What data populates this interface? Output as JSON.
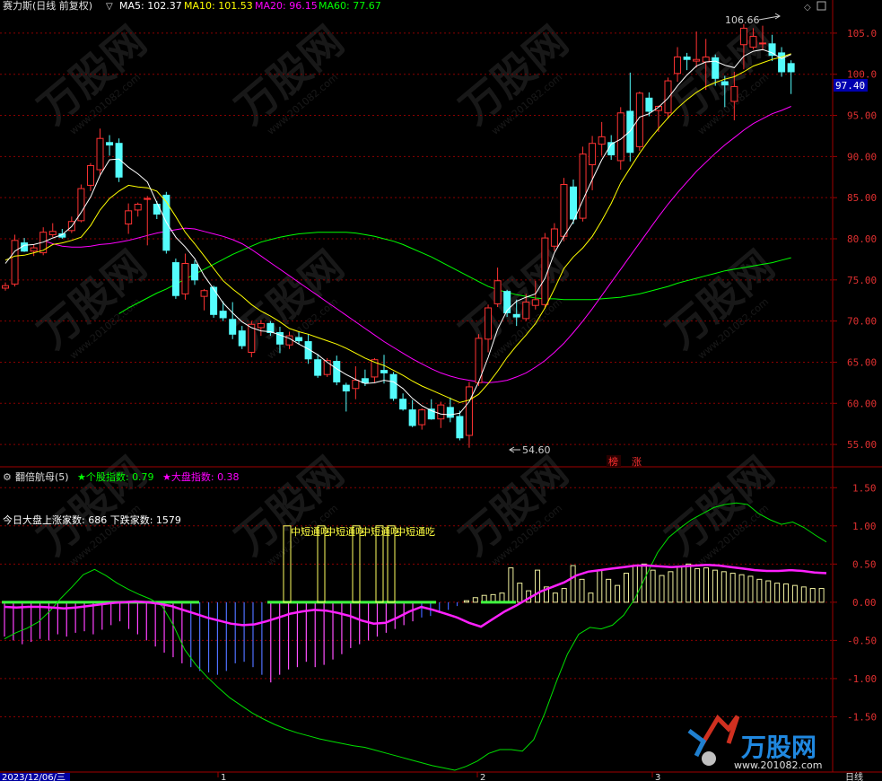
{
  "header": {
    "stock_name": "赛力斯(日线 前复权)",
    "ma5_label": "MA5: 102.37",
    "ma10_label": "MA10: 101.53",
    "ma20_label": "MA20: 96.15",
    "ma60_label": "MA60: 77.67"
  },
  "indicator_header": {
    "name": "翻倍航母(5)",
    "stock_index_label": "★个股指数: 0.79",
    "market_index_label": "★大盘指数: 0.38"
  },
  "indicator_info": "今日大盘上涨家数: 686 下跌家数: 1579",
  "signal_label": "中短通吃",
  "date_label": "2023/12/06/三",
  "period_label": "日线",
  "price_tag": "97.40",
  "high_label": "106.66",
  "low_label": "54.60",
  "board_tags": [
    "榜",
    "涨"
  ],
  "watermark": "万股网 www.201082.com",
  "chart_data": [
    {
      "type": "candlestick",
      "title": "赛力斯(日线 前复权)",
      "ylim": [
        52.5,
        107.5
      ],
      "y_ticks": [
        "105.0",
        "100.0",
        "95.00",
        "90.00",
        "85.00",
        "80.00",
        "75.00",
        "70.00",
        "65.00",
        "60.00",
        "55.00"
      ],
      "candles": [
        [
          74.0,
          74.7,
          73.7,
          74.3
        ],
        [
          74.5,
          80.5,
          74.2,
          79.8
        ],
        [
          79.5,
          80.1,
          78.4,
          78.5
        ],
        [
          78.5,
          79.3,
          77.9,
          78.9
        ],
        [
          78.3,
          81.4,
          78.0,
          80.8
        ],
        [
          80.5,
          81.9,
          80.2,
          80.9
        ],
        [
          80.6,
          81.2,
          80.0,
          80.2
        ],
        [
          81.0,
          82.7,
          80.7,
          82.1
        ],
        [
          82.2,
          86.6,
          82.0,
          86.1
        ],
        [
          86.5,
          89.2,
          85.8,
          88.9
        ],
        [
          88.4,
          93.4,
          87.8,
          92.2
        ],
        [
          91.7,
          92.6,
          90.1,
          91.4
        ],
        [
          91.6,
          92.2,
          86.9,
          87.5
        ],
        [
          81.8,
          84.3,
          80.6,
          83.4
        ],
        [
          83.5,
          84.4,
          82.7,
          84.2
        ],
        [
          84.8,
          85.2,
          79.2,
          84.9
        ],
        [
          84.2,
          84.6,
          82.4,
          83.0
        ],
        [
          85.3,
          85.7,
          78.2,
          78.6
        ],
        [
          77.1,
          77.6,
          72.7,
          73.1
        ],
        [
          73.3,
          78.2,
          72.6,
          77.0
        ],
        [
          76.9,
          77.4,
          74.4,
          75.0
        ],
        [
          73.0,
          73.9,
          71.3,
          73.7
        ],
        [
          74.1,
          74.3,
          70.4,
          70.8
        ],
        [
          71.2,
          72.4,
          70.0,
          70.4
        ],
        [
          70.2,
          72.3,
          67.8,
          68.4
        ],
        [
          68.8,
          69.4,
          66.6,
          67.0
        ],
        [
          66.2,
          70.0,
          65.6,
          69.6
        ],
        [
          69.2,
          70.1,
          68.2,
          69.7
        ],
        [
          69.7,
          70.0,
          68.2,
          68.6
        ],
        [
          68.6,
          69.3,
          66.1,
          67.2
        ],
        [
          67.1,
          68.7,
          66.6,
          68.2
        ],
        [
          68.0,
          68.7,
          67.2,
          67.6
        ],
        [
          67.5,
          68.4,
          64.8,
          65.4
        ],
        [
          65.3,
          66.0,
          63.1,
          63.4
        ],
        [
          63.5,
          65.5,
          63.2,
          65.2
        ],
        [
          65.1,
          65.8,
          62.2,
          62.6
        ],
        [
          62.2,
          62.5,
          59.0,
          61.5
        ],
        [
          61.8,
          64.5,
          60.5,
          62.8
        ],
        [
          63.0,
          64.1,
          62.1,
          62.5
        ],
        [
          63.2,
          65.5,
          62.5,
          65.3
        ],
        [
          64.0,
          65.9,
          62.4,
          63.7
        ],
        [
          63.5,
          63.8,
          60.3,
          60.6
        ],
        [
          60.5,
          61.2,
          59.1,
          59.3
        ],
        [
          59.2,
          60.4,
          57.1,
          57.3
        ],
        [
          57.4,
          59.4,
          56.8,
          59.2
        ],
        [
          59.3,
          60.5,
          58.0,
          58.1
        ],
        [
          58.1,
          60.2,
          57.0,
          59.8
        ],
        [
          59.5,
          60.7,
          57.7,
          58.3
        ],
        [
          58.4,
          59.1,
          55.5,
          55.8
        ],
        [
          56.1,
          62.6,
          54.6,
          62.0
        ],
        [
          62.5,
          68.4,
          62.1,
          67.9
        ],
        [
          67.8,
          72.0,
          66.2,
          71.6
        ],
        [
          72.1,
          76.5,
          71.7,
          74.9
        ],
        [
          73.6,
          73.8,
          70.5,
          71.0
        ],
        [
          70.8,
          72.6,
          69.4,
          70.5
        ],
        [
          70.3,
          73.3,
          70.0,
          72.3
        ],
        [
          71.9,
          74.9,
          71.4,
          72.6
        ],
        [
          72.0,
          80.7,
          71.5,
          80.1
        ],
        [
          79.1,
          81.9,
          78.5,
          81.2
        ],
        [
          80.3,
          87.4,
          79.7,
          86.6
        ],
        [
          86.3,
          87.2,
          81.8,
          82.4
        ],
        [
          82.5,
          91.2,
          82.1,
          90.3
        ],
        [
          89.0,
          92.5,
          85.9,
          91.6
        ],
        [
          91.5,
          94.2,
          90.1,
          92.4
        ],
        [
          91.7,
          92.6,
          89.6,
          90.2
        ],
        [
          89.5,
          96.0,
          88.4,
          95.3
        ],
        [
          95.5,
          100.2,
          89.4,
          90.5
        ],
        [
          91.2,
          97.9,
          90.7,
          97.7
        ],
        [
          97.1,
          97.8,
          94.9,
          95.5
        ],
        [
          95.6,
          96.2,
          93.0,
          96.1
        ],
        [
          95.3,
          99.6,
          94.6,
          99.2
        ],
        [
          100.1,
          103.3,
          99.1,
          102.1
        ],
        [
          102.1,
          102.6,
          100.5,
          101.8
        ],
        [
          101.6,
          105.2,
          100.8,
          101.8
        ],
        [
          101.5,
          104.3,
          98.1,
          102.1
        ],
        [
          102.0,
          102.4,
          98.6,
          99.5
        ],
        [
          99.1,
          99.8,
          96.0,
          98.7
        ],
        [
          96.7,
          100.3,
          94.4,
          98.5
        ],
        [
          103.6,
          106.1,
          100.6,
          105.6
        ],
        [
          103.3,
          105.6,
          103.0,
          104.6
        ],
        [
          103.7,
          105.9,
          102.9,
          103.8
        ],
        [
          103.7,
          104.8,
          101.6,
          102.3
        ],
        [
          102.6,
          103.3,
          99.7,
          100.3
        ],
        [
          101.3,
          101.7,
          97.6,
          100.3
        ]
      ],
      "series": [
        {
          "name": "MA5",
          "values": [
            77.0,
            78.5,
            79.2,
            79.3,
            79.6,
            80.1,
            80.5,
            81.5,
            83.2,
            85.1,
            87.7,
            89.6,
            89.7,
            88.7,
            87.9,
            86.9,
            84.4,
            82.0,
            80.2,
            79.0,
            77.6,
            75.5,
            73.9,
            72.2,
            71.0,
            69.9,
            69.2,
            68.8,
            68.7,
            68.3,
            67.9,
            67.2,
            66.6,
            65.9,
            65.0,
            64.2,
            63.5,
            62.9,
            62.4,
            62.5,
            62.8,
            62.6,
            61.8,
            60.6,
            59.7,
            59.1,
            58.7,
            58.6,
            58.8,
            60.2,
            62.6,
            65.6,
            69.0,
            71.3,
            72.4,
            72.9,
            73.3,
            75.2,
            78.3,
            80.3,
            82.1,
            84.7,
            87.2,
            89.6,
            91.5,
            92.1,
            93.1,
            94.8,
            95.2,
            96.0,
            97.1,
            98.6,
            99.9,
            101.0,
            101.5,
            101.6,
            101.1,
            100.8,
            102.2,
            102.8,
            103.0,
            102.6,
            101.9,
            102.4
          ]
        },
        {
          "name": "MA10",
          "values": [
            77.4,
            77.9,
            78.0,
            78.3,
            78.6,
            79.3,
            79.5,
            79.8,
            80.2,
            81.6,
            83.5,
            84.9,
            85.8,
            86.5,
            86.3,
            86.2,
            85.8,
            84.5,
            82.7,
            80.8,
            79.4,
            77.9,
            76.4,
            74.9,
            73.9,
            73.0,
            72.0,
            71.2,
            70.6,
            69.9,
            69.1,
            68.7,
            68.4,
            68.0,
            67.6,
            67.2,
            66.7,
            66.1,
            65.5,
            65.0,
            64.6,
            64.0,
            63.4,
            62.7,
            62.1,
            61.6,
            61.1,
            60.6,
            60.1,
            60.4,
            61.1,
            62.4,
            63.9,
            65.6,
            67.0,
            68.3,
            69.7,
            71.6,
            73.9,
            76.4,
            77.8,
            78.9,
            80.3,
            82.2,
            84.3,
            86.8,
            88.6,
            90.4,
            92.0,
            93.4,
            94.7,
            95.9,
            96.9,
            97.8,
            98.5,
            99.0,
            99.4,
            99.7,
            100.3,
            101.0,
            101.4,
            101.8,
            102.1,
            102.5
          ]
        },
        {
          "name": "MA20",
          "values": [
            79.8,
            79.4,
            79.1,
            79.0,
            79.0,
            79.1,
            79.3,
            79.4,
            79.6,
            79.8,
            80.1,
            80.4,
            80.7,
            80.9,
            81.1,
            81.3,
            81.2,
            80.9,
            80.6,
            80.3,
            79.9,
            79.4,
            78.7,
            77.9,
            77.1,
            76.3,
            75.5,
            74.7,
            73.9,
            73.1,
            72.3,
            71.5,
            70.7,
            69.9,
            69.1,
            68.3,
            67.5,
            66.8,
            66.1,
            65.4,
            64.8,
            64.2,
            63.7,
            63.3,
            63.0,
            62.8,
            62.6,
            62.5,
            62.6,
            62.8,
            63.2,
            63.7,
            64.4,
            65.2,
            66.2,
            67.3,
            68.6,
            70.0,
            71.5,
            73.1,
            74.7,
            76.3,
            77.9,
            79.5,
            81.1,
            82.7,
            84.2,
            85.6,
            86.9,
            88.2,
            89.3,
            90.4,
            91.4,
            92.3,
            93.2,
            94.0,
            94.6,
            95.2,
            95.6,
            96.1
          ]
        },
        {
          "name": "MA60",
          "values": [
            70.9,
            71.6,
            72.2,
            72.8,
            73.4,
            73.9,
            74.5,
            75.1,
            75.7,
            76.3,
            76.9,
            77.5,
            78.1,
            78.6,
            79.1,
            79.6,
            79.9,
            80.2,
            80.4,
            80.6,
            80.7,
            80.8,
            80.8,
            80.8,
            80.8,
            80.7,
            80.5,
            80.3,
            80.0,
            79.7,
            79.3,
            78.8,
            78.3,
            77.8,
            77.2,
            76.6,
            76.0,
            75.4,
            74.8,
            74.2,
            73.8,
            73.5,
            73.2,
            73.0,
            72.8,
            72.7,
            72.7,
            72.6,
            72.6,
            72.6,
            72.6,
            72.7,
            72.8,
            72.9,
            73.1,
            73.3,
            73.6,
            73.9,
            74.2,
            74.6,
            74.9,
            75.2,
            75.5,
            75.8,
            76.1,
            76.3,
            76.5,
            76.7,
            76.9,
            77.1,
            77.4,
            77.7
          ]
        }
      ]
    },
    {
      "type": "line",
      "title": "翻倍航母(5)",
      "ylim": [
        -2.2,
        1.75
      ],
      "y_ticks": [
        "1.50",
        "1.00",
        "0.50",
        "0.00",
        "-0.50",
        "-1.00",
        "-1.50"
      ],
      "series": [
        {
          "name": "个股指数",
          "values": [
            -0.48,
            -0.4,
            -0.34,
            -0.26,
            -0.12,
            0.05,
            0.2,
            0.36,
            0.43,
            0.35,
            0.25,
            0.17,
            0.1,
            0.04,
            -0.05,
            -0.3,
            -0.62,
            -0.82,
            -0.98,
            -1.12,
            -1.25,
            -1.35,
            -1.45,
            -1.53,
            -1.6,
            -1.66,
            -1.71,
            -1.75,
            -1.79,
            -1.82,
            -1.85,
            -1.88,
            -1.9,
            -1.94,
            -1.98,
            -2.02,
            -2.06,
            -2.1,
            -2.14,
            -2.17,
            -2.2,
            -2.15,
            -2.08,
            -1.98,
            -1.93,
            -1.93,
            -1.95,
            -1.8,
            -1.45,
            -1.05,
            -0.68,
            -0.42,
            -0.33,
            -0.35,
            -0.3,
            -0.17,
            0.05,
            0.35,
            0.65,
            0.85,
            0.97,
            1.08,
            1.16,
            1.24,
            1.28,
            1.3,
            1.28,
            1.16,
            1.08,
            1.02,
            1.05,
            0.98,
            0.88,
            0.79
          ]
        },
        {
          "name": "大盘指数",
          "values": [
            -0.06,
            -0.07,
            -0.06,
            -0.06,
            -0.07,
            -0.08,
            -0.07,
            -0.05,
            -0.03,
            -0.01,
            0.0,
            0.01,
            0.0,
            -0.02,
            -0.05,
            -0.1,
            -0.15,
            -0.2,
            -0.24,
            -0.28,
            -0.3,
            -0.29,
            -0.25,
            -0.2,
            -0.15,
            -0.12,
            -0.1,
            -0.11,
            -0.14,
            -0.18,
            -0.24,
            -0.28,
            -0.27,
            -0.2,
            -0.12,
            -0.06,
            -0.1,
            -0.15,
            -0.2,
            -0.27,
            -0.32,
            -0.22,
            -0.12,
            -0.04,
            0.05,
            0.14,
            0.2,
            0.26,
            0.35,
            0.4,
            0.42,
            0.44,
            0.46,
            0.48,
            0.48,
            0.47,
            0.46,
            0.47,
            0.48,
            0.49,
            0.48,
            0.46,
            0.44,
            0.42,
            0.41,
            0.41,
            0.42,
            0.41,
            0.39,
            0.38
          ]
        },
        {
          "name": "bars",
          "values": [
            -0.45,
            -0.5,
            -0.55,
            -0.52,
            -0.48,
            -0.5,
            -0.42,
            -0.45,
            -0.4,
            -0.38,
            -0.42,
            -0.36,
            -0.3,
            -0.25,
            -0.35,
            -0.42,
            -0.5,
            -0.58,
            -0.66,
            -0.72,
            -0.8,
            -0.85,
            -0.9,
            -0.92,
            -0.95,
            -0.9,
            -0.8,
            -0.78,
            -0.85,
            -0.95,
            -1.05,
            -0.95,
            -0.88,
            -0.85,
            -0.78,
            -0.85,
            -0.82,
            -0.75,
            -0.68,
            -0.6,
            -0.55,
            -0.5,
            -0.45,
            -0.4,
            -0.35,
            -0.3,
            -0.25,
            -0.2,
            -0.18,
            -0.14,
            -0.1,
            -0.05,
            0.02,
            0.06,
            0.09,
            0.1,
            0.12,
            0.45,
            0.25,
            0.15,
            0.42,
            0.2,
            0.12,
            0.18,
            0.48,
            0.3,
            0.12,
            0.42,
            0.3,
            0.22,
            0.38,
            0.48,
            0.5,
            0.42,
            0.35,
            0.4,
            0.46,
            0.5,
            0.44,
            0.45,
            0.42,
            0.4,
            0.38,
            0.36,
            0.34,
            0.3,
            0.28,
            0.25,
            0.24,
            0.22,
            0.2,
            0.18,
            0.18
          ]
        },
        {
          "name": "signals",
          "values": [
            1.0,
            1.0,
            1.0,
            1.0,
            1.0
          ]
        }
      ]
    }
  ]
}
